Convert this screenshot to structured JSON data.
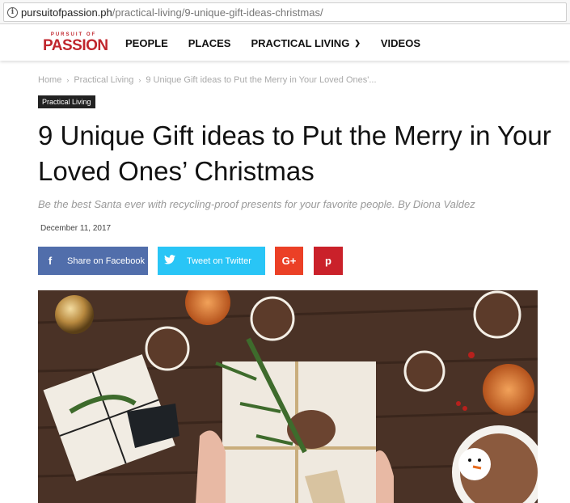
{
  "browser": {
    "url_host": "pursuitofpassion.ph",
    "url_path": "/practical-living/9-unique-gift-ideas-christmas/"
  },
  "header": {
    "logo_top": "PURSUIT OF",
    "logo_main": "PASSION",
    "nav": [
      "PEOPLE",
      "PLACES",
      "PRACTICAL LIVING",
      "VIDEOS"
    ]
  },
  "breadcrumb": {
    "home": "Home",
    "section": "Practical Living",
    "current": "9 Unique Gift ideas to Put the Merry in Your Loved Ones'..."
  },
  "article": {
    "category": "Practical Living",
    "title": "9 Unique Gift ideas to Put the Merry in Your Loved Ones’ Christmas",
    "subtitle": "Be the best Santa ever with recycling-proof presents for your favorite people. By Diona Valdez",
    "date": "December 11, 2017"
  },
  "share": {
    "facebook_label": "Share on Facebook",
    "twitter_label": "Tweet on Twitter",
    "facebook_icon": "f",
    "twitter_icon": "twitter-bird",
    "googleplus_icon": "G+",
    "pinterest_icon": "p"
  },
  "colors": {
    "brand": "#c0262d",
    "facebook": "#516eab",
    "twitter": "#29c5f6",
    "googleplus": "#eb4026",
    "pinterest": "#ca212a"
  }
}
